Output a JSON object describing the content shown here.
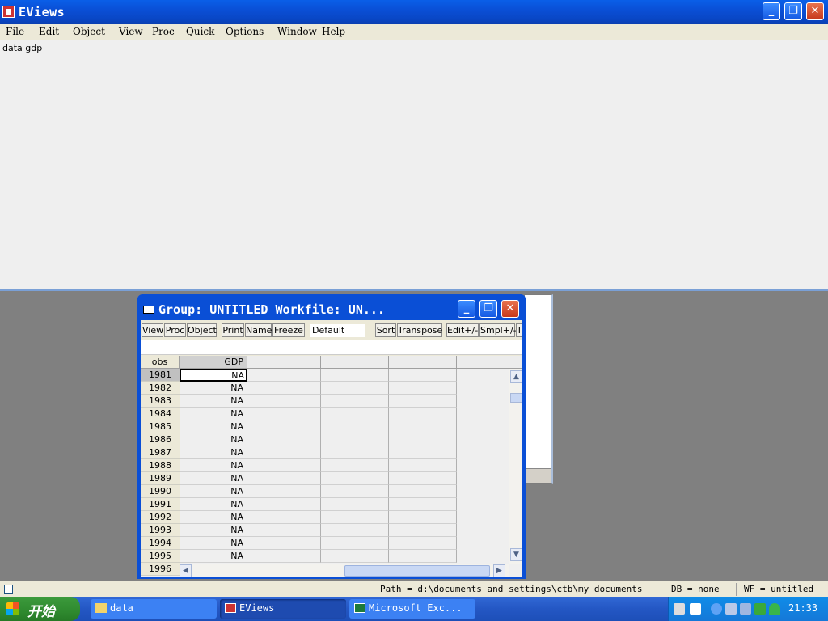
{
  "app": {
    "title": "EViews",
    "menus": [
      "File",
      "Edit",
      "Object",
      "View",
      "Proc",
      "Quick",
      "Options",
      "Window",
      "Help"
    ],
    "window_buttons": {
      "minimize": "_",
      "maximize": "❐",
      "close": "✕"
    }
  },
  "command": {
    "text": "data gdp"
  },
  "group_window": {
    "title": "Group: UNTITLED   Workfile: UN...",
    "toolbar": [
      "View",
      "Proc",
      "Object",
      "Print",
      "Name",
      "Freeze",
      "Sort",
      "Transpose",
      "Edit+/-",
      "Smpl+/-",
      "T"
    ],
    "display_combo": "Default",
    "table": {
      "headers": [
        "obs",
        "GDP"
      ],
      "rows": [
        {
          "obs": "1981",
          "gdp": "NA"
        },
        {
          "obs": "1982",
          "gdp": "NA"
        },
        {
          "obs": "1983",
          "gdp": "NA"
        },
        {
          "obs": "1984",
          "gdp": "NA"
        },
        {
          "obs": "1985",
          "gdp": "NA"
        },
        {
          "obs": "1986",
          "gdp": "NA"
        },
        {
          "obs": "1987",
          "gdp": "NA"
        },
        {
          "obs": "1988",
          "gdp": "NA"
        },
        {
          "obs": "1989",
          "gdp": "NA"
        },
        {
          "obs": "1990",
          "gdp": "NA"
        },
        {
          "obs": "1991",
          "gdp": "NA"
        },
        {
          "obs": "1992",
          "gdp": "NA"
        },
        {
          "obs": "1993",
          "gdp": "NA"
        },
        {
          "obs": "1994",
          "gdp": "NA"
        },
        {
          "obs": "1995",
          "gdp": "NA"
        },
        {
          "obs": "1996",
          "gdp": ""
        }
      ]
    }
  },
  "statusbar": {
    "path": "Path = d:\\documents and settings\\ctb\\my documents",
    "db": "DB = none",
    "wf": "WF = untitled"
  },
  "taskbar": {
    "start_label": "开始",
    "tasks": [
      "data",
      "EViews",
      "Microsoft Exc..."
    ],
    "clock": "21:33"
  }
}
